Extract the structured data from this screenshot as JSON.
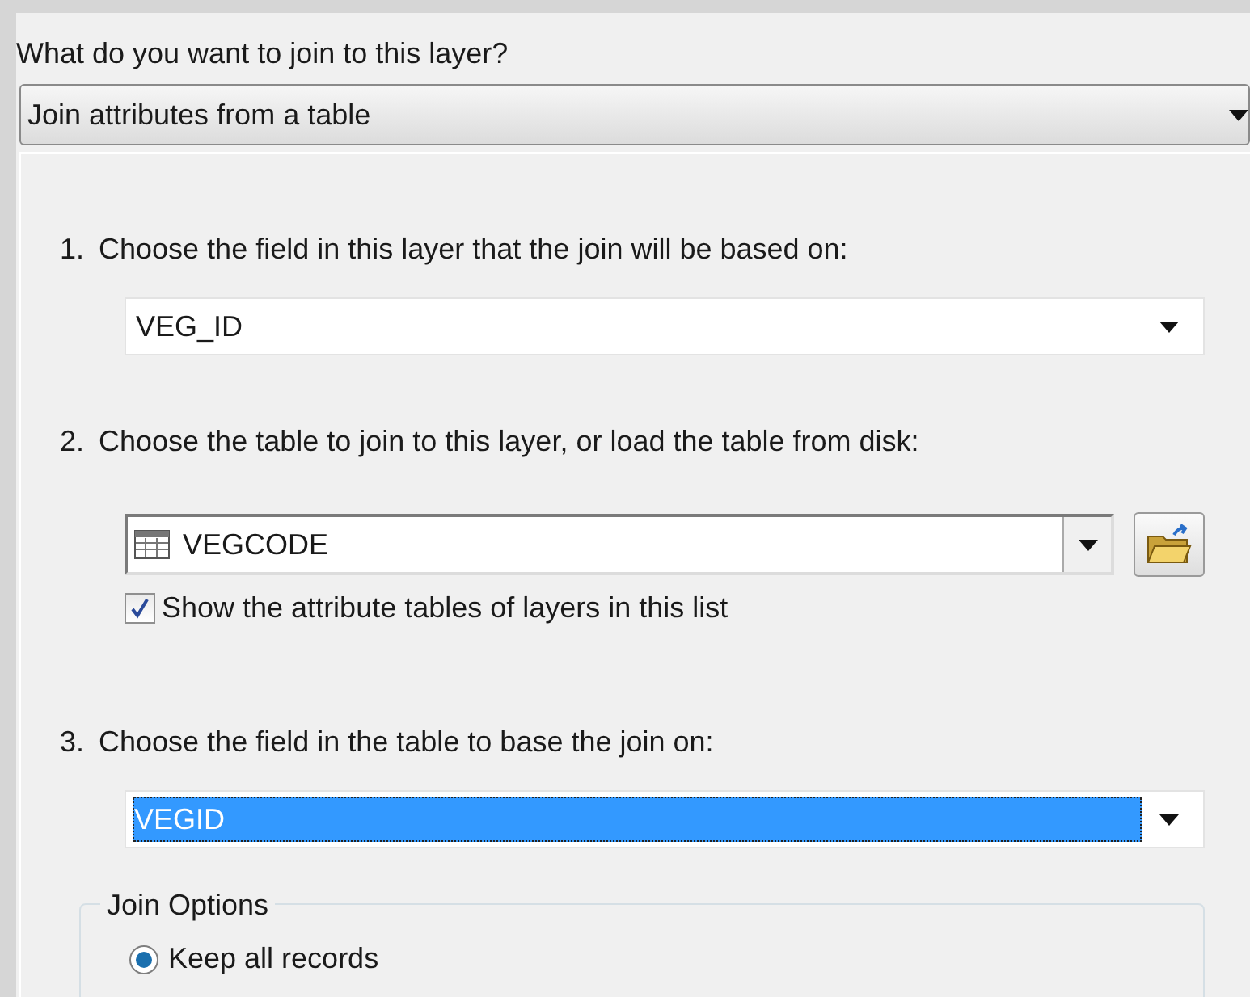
{
  "question": "What do you want to join to this layer?",
  "join_type": {
    "value": "Join attributes from a table"
  },
  "steps": [
    {
      "label": "1.",
      "text": "Choose the field in this layer that the join will be based on:",
      "field": {
        "kind": "dropdown",
        "value": "VEG_ID",
        "selected": false
      }
    },
    {
      "label": "2.",
      "text": "Choose the table to join to this layer, or load the table from disk:",
      "field": {
        "kind": "table-combo",
        "value": "VEGCODE",
        "selected": false
      },
      "checkbox": {
        "label": "Show the attribute tables of layers in this list",
        "checked": true
      }
    },
    {
      "label": "3.",
      "text": "Choose the field in the table to base the join on:",
      "field": {
        "kind": "dropdown",
        "value": "VEGID",
        "selected": true
      }
    }
  ],
  "join_options": {
    "title": "Join Options",
    "options": [
      {
        "label": "Keep all records",
        "selected": true
      }
    ]
  }
}
